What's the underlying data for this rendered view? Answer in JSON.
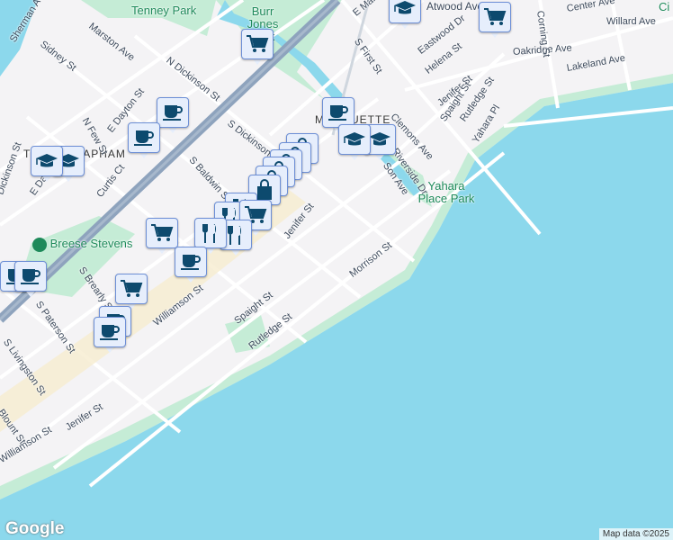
{
  "map": {
    "colors": {
      "land": "#f4f3f5",
      "water": "#8cd8ec",
      "park": "#c5ecd6",
      "highway": "#8ea3bd",
      "road": "#ffffff",
      "marker_icon": "#0d4a6e"
    },
    "labels": {
      "parks": [
        "Tenney Park",
        "Burr Jones Park",
        "Yahara Place Park",
        "Breese Stevens"
      ],
      "neighborhoods": [
        "TENNEY-LAPHAM",
        "MARQUETTE"
      ],
      "streets": [
        "Sherman Ave",
        "Sidney St",
        "Marston Ave",
        "N Dickinson St",
        "S Dickinson St",
        "E Dayton St",
        "N Few St",
        "Curtis Ct",
        "S Baldwin St",
        "Jenifer St",
        "Williamson St",
        "Spaight St",
        "Rutledge St",
        "S Brearly St",
        "S Paterson St",
        "S Livingston St",
        "Blount St",
        "Morrison St",
        "S First St",
        "Eastwood Dr",
        "Helena St",
        "Oakridge Ave",
        "Lakeland Ave",
        "Center Ave",
        "Willard Ave",
        "Clemons Ave",
        "Riverside Dr",
        "Yahara Pl",
        "E Main St",
        "Atwood Ave",
        "Dickinson St",
        "Few St",
        "Corning St",
        "E Dayton St",
        "Jenifer St",
        "Spaight St",
        "Rutledge St",
        "Son Ave",
        "Williamson St",
        "Ci"
      ]
    },
    "markers": [
      "graduation-cap",
      "shopping-cart",
      "shopping-cart",
      "coffee-cup",
      "coffee-cup",
      "coffee-cup",
      "graduation-cap",
      "graduation-cap",
      "graduation-cap",
      "graduation-cap",
      "shopping-bag",
      "shopping-bag",
      "shopping-bag",
      "shopping-bag",
      "shopping-bag",
      "shopping-bag",
      "restaurant",
      "restaurant",
      "shopping-cart",
      "shopping-cart",
      "restaurant",
      "restaurant",
      "coffee-cup",
      "coffee-cup",
      "coffee-cup",
      "shopping-cart",
      "coffee-cup",
      "coffee-cup"
    ],
    "logo": "Google",
    "attribution": "Map data ©2025"
  }
}
